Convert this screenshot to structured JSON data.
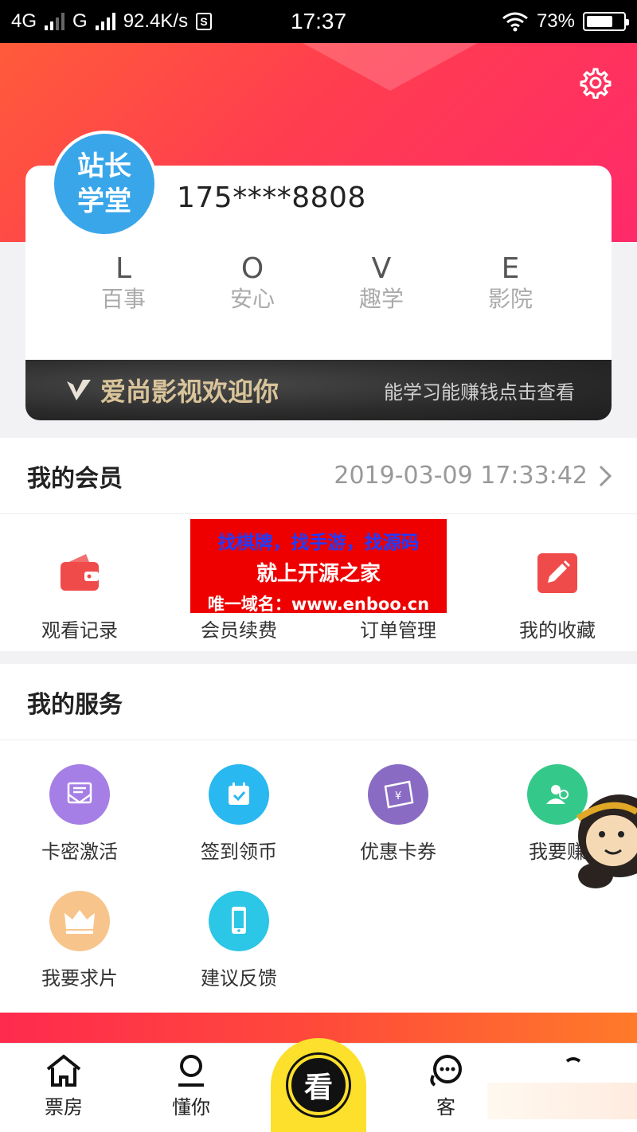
{
  "status_bar": {
    "network1": "4G",
    "network2": "G",
    "speed": "92.4K/s",
    "sim_icon_label": "S",
    "time": "17:37",
    "battery_percent": "73%",
    "battery_level": 0.73
  },
  "profile": {
    "avatar_line1": "站长",
    "avatar_line2": "学堂",
    "phone": "175****8808",
    "love": [
      {
        "letter": "L",
        "word": "百事"
      },
      {
        "letter": "O",
        "word": "安心"
      },
      {
        "letter": "V",
        "word": "趣学"
      },
      {
        "letter": "E",
        "word": "影院"
      }
    ],
    "banner_logo": "V",
    "banner_title": "爱尚影视欢迎你",
    "banner_link": "能学习能赚钱点击查看"
  },
  "membership": {
    "title": "我的会员",
    "expiry": "2019-03-09 17:33:42",
    "items": [
      {
        "label": "观看记录",
        "icon": "wallet-icon"
      },
      {
        "label": "会员续费",
        "icon": "renew-icon"
      },
      {
        "label": "订单管理",
        "icon": "order-icon"
      },
      {
        "label": "我的收藏",
        "icon": "edit-icon"
      }
    ]
  },
  "ad": {
    "line1": "找棋牌，找手游，找源码",
    "line2": "就上开源之家",
    "line3": "唯一域名：www.enboo.cn"
  },
  "services": {
    "title": "我的服务",
    "items": [
      {
        "label": "卡密激活",
        "icon": "mail-card-icon",
        "color": "#a57fe6"
      },
      {
        "label": "签到领币",
        "icon": "calendar-check-icon",
        "color": "#29b8f0"
      },
      {
        "label": "优惠卡券",
        "icon": "coupon-icon",
        "color": "#8a6bc4"
      },
      {
        "label": "我要赚",
        "icon": "user-add-icon",
        "color": "#34c98a"
      },
      {
        "label": "我要求片",
        "icon": "crown-icon",
        "color": "#f7c58c"
      },
      {
        "label": "建议反馈",
        "icon": "phone-icon",
        "color": "#2cc6e6"
      }
    ]
  },
  "tabbar": {
    "tabs": [
      {
        "label": "票房",
        "icon": "home-icon"
      },
      {
        "label": "懂你",
        "icon": "person-icon"
      },
      {
        "label": "看",
        "icon": "watch-icon"
      },
      {
        "label": "客",
        "icon": "chat-icon"
      },
      {
        "label": "",
        "icon": "profile-icon"
      }
    ]
  },
  "colors": {
    "header_start": "#ff5b3a",
    "header_end": "#ff2a6a",
    "avatar_bg": "#3aa6ea",
    "center_tab": "#fde02b",
    "ad_bg": "#ee0000"
  }
}
